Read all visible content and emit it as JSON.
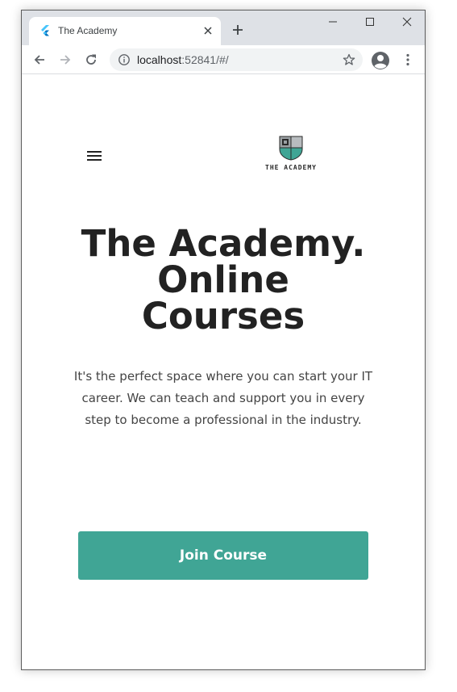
{
  "browser": {
    "tab": {
      "title": "The Academy",
      "favicon": "flutter-icon"
    },
    "address": {
      "host": "localhost",
      "rest": ":52841/#/"
    },
    "icons": {
      "back": "back-arrow-icon",
      "forward": "forward-arrow-icon",
      "reload": "reload-icon",
      "info": "info-icon",
      "star": "star-icon",
      "profile": "profile-icon",
      "menu": "kebab-menu-icon",
      "new_tab": "plus-icon",
      "close_tab": "close-icon"
    }
  },
  "page": {
    "logo_text": "THE ACADEMY",
    "title_lines": [
      "The Academy.",
      "Online",
      "Courses"
    ],
    "description": "It's the perfect space where you can start your IT career. We can teach and support you in every step to become a professional in the industry.",
    "join_button_label": "Join Course"
  },
  "colors": {
    "accent": "#40a595",
    "title": "#222222",
    "body_text": "#444444",
    "tab_strip": "#dee1e6"
  }
}
